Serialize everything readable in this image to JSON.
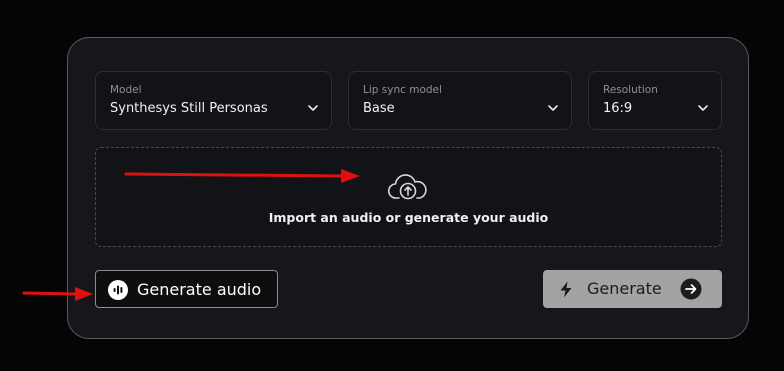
{
  "selects": [
    {
      "label": "Model",
      "value": "Synthesys Still Personas",
      "icon": "chevron-down-icon"
    },
    {
      "label": "Lip sync model",
      "value": "Base",
      "icon": "chevron-down-icon"
    },
    {
      "label": "Resolution",
      "value": "16:9",
      "icon": "chevron-down-icon"
    }
  ],
  "dropzone": {
    "text": "Import an audio or generate your audio",
    "icon": "cloud-upload-icon"
  },
  "buttons": {
    "generate_audio": {
      "label": "Generate audio",
      "icon": "audio-wave-icon"
    },
    "generate": {
      "label": "Generate",
      "icon": "lightning-icon",
      "trailing_icon": "arrow-right-circle-icon"
    }
  },
  "colors": {
    "background": "#050505",
    "panel": "#16171a",
    "annotation_arrow": "#e01010",
    "generate_button": "#a3a3a5"
  }
}
